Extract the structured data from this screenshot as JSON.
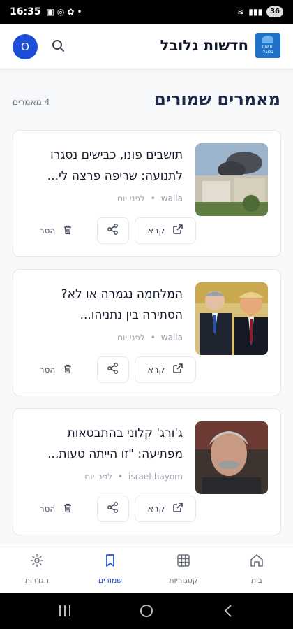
{
  "status": {
    "time": "16:35",
    "battery": "36"
  },
  "header": {
    "brand": "חדשות גלובל",
    "logo_line1": "חדשות",
    "logo_line2": "גלובל",
    "avatar": "O"
  },
  "page": {
    "title": "מאמרים שמורים",
    "count": "4 מאמרים"
  },
  "actions": {
    "read": "קרא",
    "remove": "הסר"
  },
  "articles": [
    {
      "line1": "תושבים פונו, כבישים נסגרו",
      "line2": "לתנועה: שריפה פרצה לי...",
      "source": "walla",
      "time": "לפני יום"
    },
    {
      "line1": "המלחמה נגמרה או לא?",
      "line2": "הסתירה בין נתניהו...",
      "source": "walla",
      "time": "לפני יום"
    },
    {
      "line1": "ג'ורג' קלוני בהתבטאות",
      "line2": "מפתיעה: \"זו הייתה טעות...",
      "source": "israel-hayom",
      "time": "לפני יום"
    }
  ],
  "nav": {
    "home": "בית",
    "categories": "קטגוריות",
    "saved": "שמורים",
    "settings": "הגדרות"
  },
  "colors": {
    "accent": "#1d4ed8",
    "title": "#1e2a4a"
  }
}
